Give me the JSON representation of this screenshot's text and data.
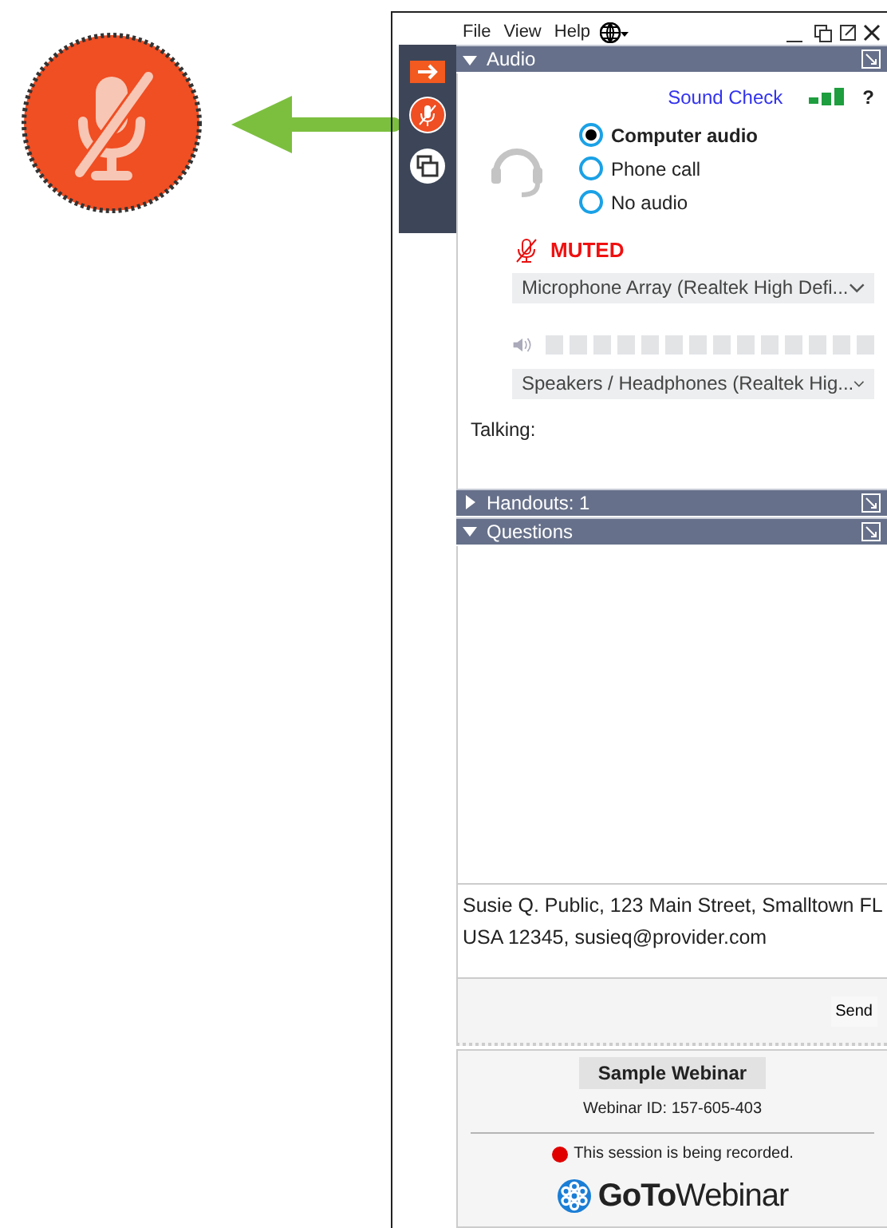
{
  "menu": [
    "File",
    "View",
    "Help"
  ],
  "audio": {
    "title": "Audio",
    "expanded": true,
    "sound_check": "Sound Check",
    "help": "?",
    "options": [
      {
        "label": "Computer audio",
        "selected": true
      },
      {
        "label": "Phone call",
        "selected": false
      },
      {
        "label": "No audio",
        "selected": false
      }
    ],
    "muted": true,
    "muted_label": "MUTED",
    "microphone": "Microphone Array (Realtek High Defi...",
    "speaker": "Speakers / Headphones (Realtek Hig...",
    "talking_label": "Talking:"
  },
  "sections": [
    {
      "title": "Handouts: 1",
      "expanded": false
    },
    {
      "title": "Questions",
      "expanded": true
    }
  ],
  "question_input": {
    "value": "Susie Q. Public, 123 Main Street, Smalltown FL USA 12345, susieq@provider.com"
  },
  "send_button": "Send",
  "footer": {
    "webinar_title": "Sample Webinar",
    "webinar_id": "Webinar ID: 157-605-403",
    "recording": "This session is being recorded.",
    "logo_bold": "GoTo",
    "logo_light": "Webinar"
  }
}
